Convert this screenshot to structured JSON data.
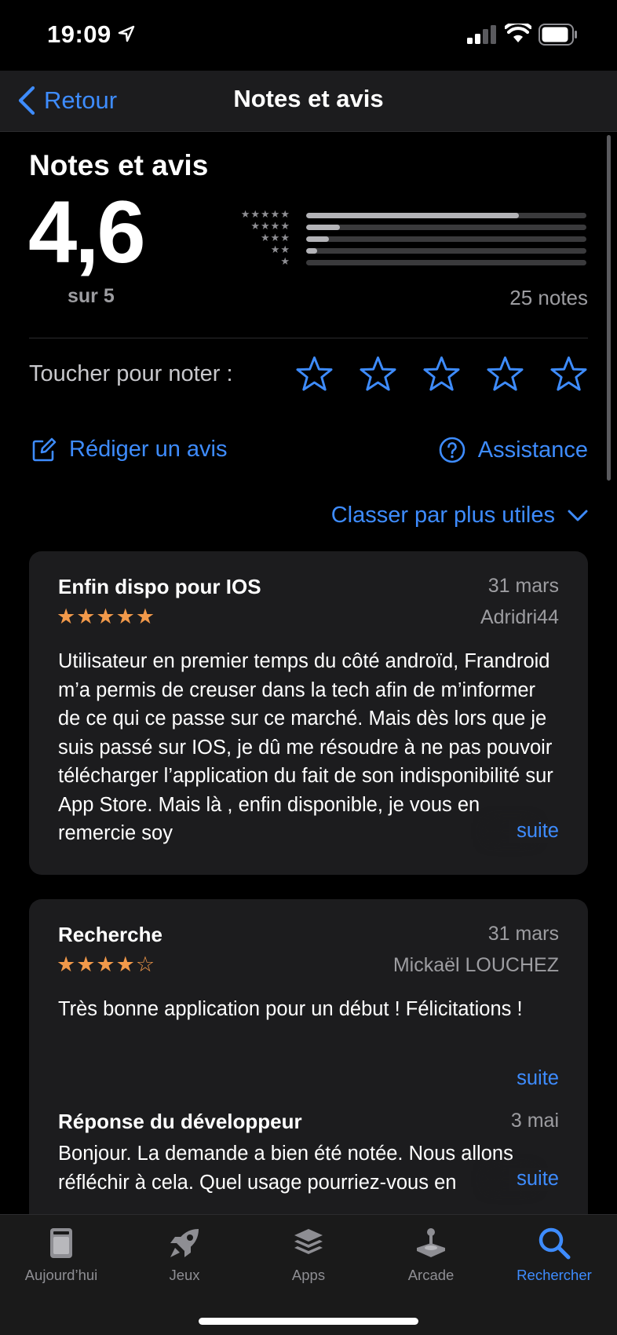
{
  "status_bar": {
    "time": "19:09"
  },
  "nav": {
    "back_label": "Retour",
    "title": "Notes et avis"
  },
  "ratings": {
    "section_title": "Notes et avis",
    "average": "4,6",
    "out_of": "sur 5",
    "count_label": "25 notes",
    "histogram": [
      {
        "stars": "★★★★★",
        "fraction": 0.76
      },
      {
        "stars": "★★★★",
        "fraction": 0.12
      },
      {
        "stars": "★★★",
        "fraction": 0.08
      },
      {
        "stars": "★★",
        "fraction": 0.04
      },
      {
        "stars": "★",
        "fraction": 0.0
      }
    ]
  },
  "tap_to_rate": {
    "label": "Toucher pour noter :"
  },
  "actions": {
    "write_review": "Rédiger un avis",
    "support": "Assistance"
  },
  "sort": {
    "label": "Classer par plus utiles"
  },
  "reviews": [
    {
      "title": "Enfin dispo pour IOS",
      "date": "31 mars",
      "stars": "★★★★★",
      "rating": 5,
      "author": "Adridri44",
      "body": "Utilisateur en premier temps du côté androïd, Frandroid m’a permis de creuser dans la tech afin de m’informer de ce qui ce passe sur ce marché. Mais dès lors que je suis passé sur IOS, je dû me résoudre à ne pas pouvoir télécharger l’application du fait de son indisponibilité sur App Store. Mais là , enfin disponible,  je vous en remercie soy",
      "more": "suite"
    },
    {
      "title": "Recherche",
      "date": "31 mars",
      "stars": "★★★★☆",
      "rating": 4,
      "author": "Mickaël LOUCHEZ",
      "body": "Très bonne application pour un début ! Félicitations !",
      "more": "suite",
      "dev_response": {
        "title": "Réponse du développeur",
        "date": "3 mai",
        "body": "Bonjour. La demande a bien été notée. Nous allons réfléchir à cela. Quel usage pourriez-vous en",
        "more": "suite"
      }
    }
  ],
  "tab_bar": {
    "tabs": [
      {
        "label": "Aujourd’hui",
        "icon": "today-icon"
      },
      {
        "label": "Jeux",
        "icon": "rocket-icon"
      },
      {
        "label": "Apps",
        "icon": "apps-stack-icon"
      },
      {
        "label": "Arcade",
        "icon": "joystick-icon"
      },
      {
        "label": "Rechercher",
        "icon": "search-icon",
        "active": true
      }
    ]
  },
  "colors": {
    "accent": "#3e8cff",
    "star_orange": "#f2994a",
    "card_bg": "#1c1c1e",
    "secondary_text": "#9d9da1"
  }
}
